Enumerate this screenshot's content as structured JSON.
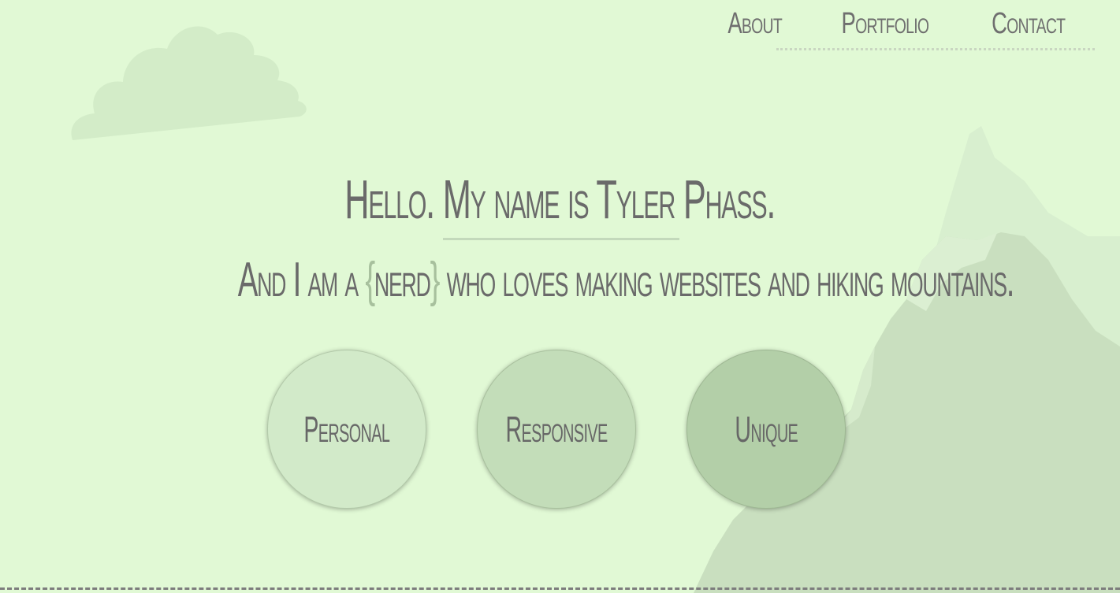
{
  "nav": {
    "items": [
      {
        "label": "About"
      },
      {
        "label": "Portfolio"
      },
      {
        "label": "Contact"
      }
    ]
  },
  "hero": {
    "headline": "Hello. My name is Tyler Phass.",
    "tagline_before": "And I am a ",
    "tagline_brace_open": "{",
    "tagline_highlight": "nerd",
    "tagline_brace_close": "}",
    "tagline_after": " who loves making websites and hiking mountains."
  },
  "features": [
    {
      "label": "Personal",
      "color": "#d2eac9"
    },
    {
      "label": "Responsive",
      "color": "#c3ddb9"
    },
    {
      "label": "Unique",
      "color": "#b3cfa8"
    }
  ],
  "colors": {
    "background": "#e1f9d5",
    "text": "#6a6a6a",
    "accent": "#a7c09d",
    "mountain": "#c7dcbd",
    "cloud": "#d4ecc9"
  }
}
